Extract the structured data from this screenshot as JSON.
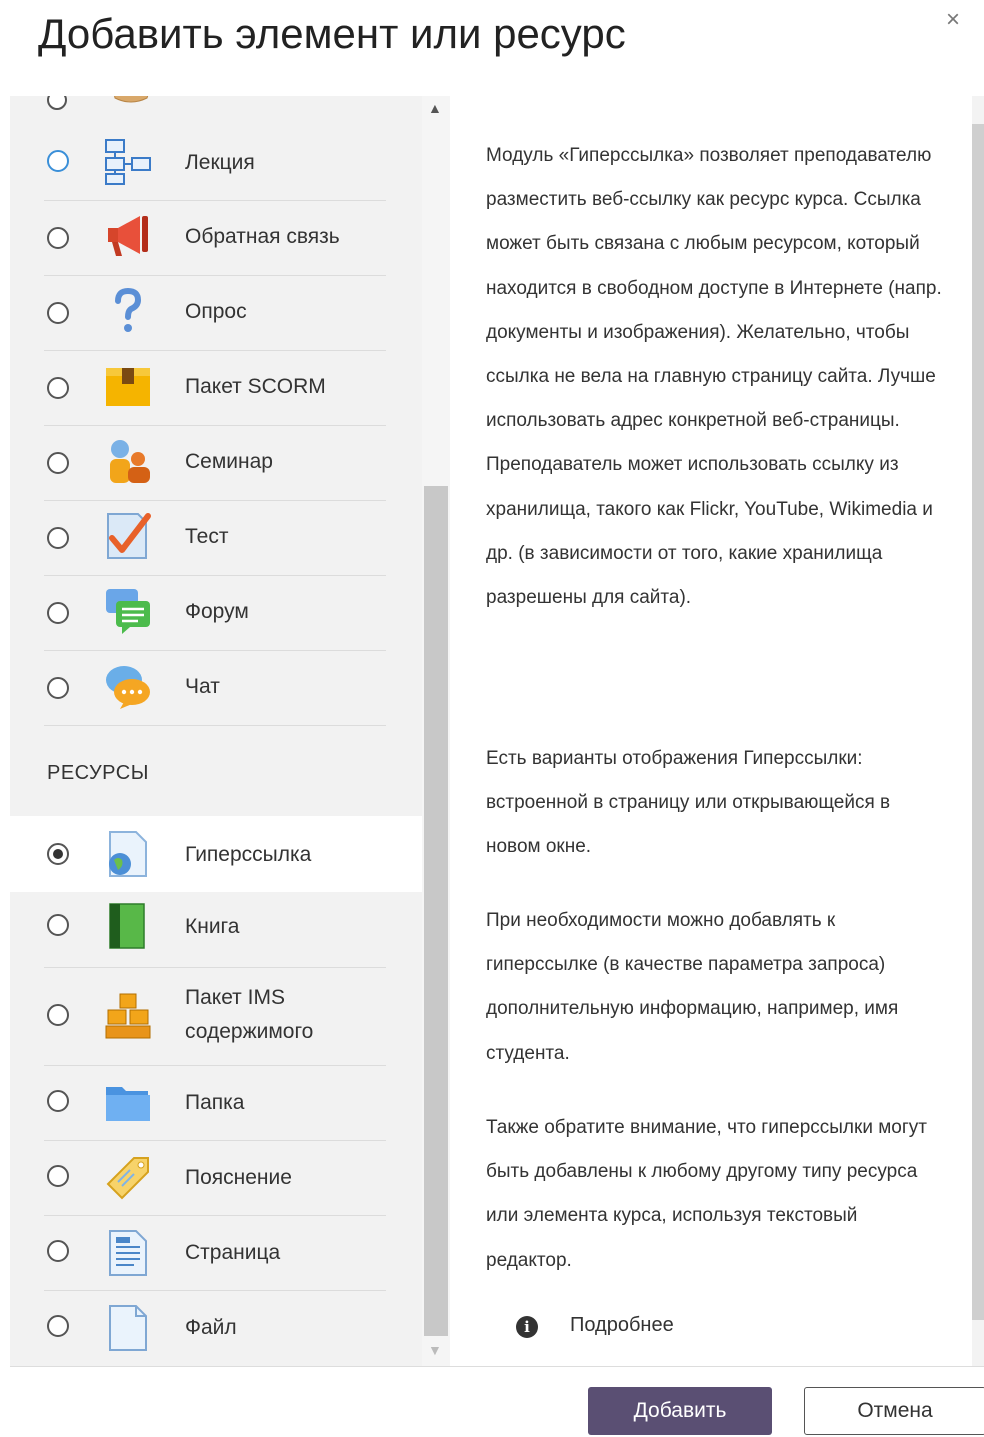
{
  "dialog": {
    "title": "Добавить элемент или ресурс",
    "close_symbol": "×"
  },
  "activities": [
    {
      "label": "Лекция",
      "icon": "lesson-icon",
      "selected": false
    },
    {
      "label": "Обратная связь",
      "icon": "feedback-megaphone-icon",
      "selected": false
    },
    {
      "label": "Опрос",
      "icon": "question-mark-icon",
      "selected": false
    },
    {
      "label": "Пакет SCORM",
      "icon": "scorm-package-icon",
      "selected": false
    },
    {
      "label": "Семинар",
      "icon": "workshop-people-icon",
      "selected": false
    },
    {
      "label": "Тест",
      "icon": "quiz-checkmark-icon",
      "selected": false
    },
    {
      "label": "Форум",
      "icon": "forum-icon",
      "selected": false
    },
    {
      "label": "Чат",
      "icon": "chat-bubble-icon",
      "selected": false
    }
  ],
  "resources_heading": "РЕСУРСЫ",
  "resources": [
    {
      "label": "Гиперссылка",
      "icon": "url-globe-icon",
      "selected": true
    },
    {
      "label": "Книга",
      "icon": "book-icon",
      "selected": false
    },
    {
      "label": "Пакет IMS\nсодержимого",
      "icon": "ims-package-icon",
      "selected": false
    },
    {
      "label": "Папка",
      "icon": "folder-icon",
      "selected": false
    },
    {
      "label": "Пояснение",
      "icon": "label-tag-icon",
      "selected": false
    },
    {
      "label": "Страница",
      "icon": "page-icon",
      "selected": false
    },
    {
      "label": "Файл",
      "icon": "file-icon",
      "selected": false
    }
  ],
  "description": {
    "p1": "Модуль «Гиперссылка» позволяет преподавателю разместить веб-ссылку как ресурс курса. Ссылка может быть связана с любым ресурсом, который находится в свободном доступе в Интернете (напр. документы и изображения). Желательно, чтобы ссылка не вела на главную страницу сайта. Лучше использовать адрес конкретной веб-страницы. Преподаватель может использовать ссылку из хранилища, такого как Flickr, YouTube, Wikimedia и др. (в зависимости от того, какие хранилища разрешены для сайта).",
    "p2": "Есть варианты отображения Гиперссылки: встроенной в страницу или открывающейся в новом окне.",
    "p3": "При необходимости можно добавлять к гиперссылке (в качестве параметра запроса) дополнительную информацию, например, имя студента.",
    "p4": "Также обратите внимание, что гиперссылки могут быть добавлены к любому другому типу ресурса или элемента курса, используя текстовый редактор.",
    "more_label": "Подробнее"
  },
  "footer": {
    "add_label": "Добавить",
    "cancel_label": "Отмена"
  },
  "colors": {
    "primary_button": "#5a4f73",
    "selected_row": "#ffffff",
    "list_bg": "#f2f2f2",
    "focus_radio": "#3a8fd8"
  }
}
